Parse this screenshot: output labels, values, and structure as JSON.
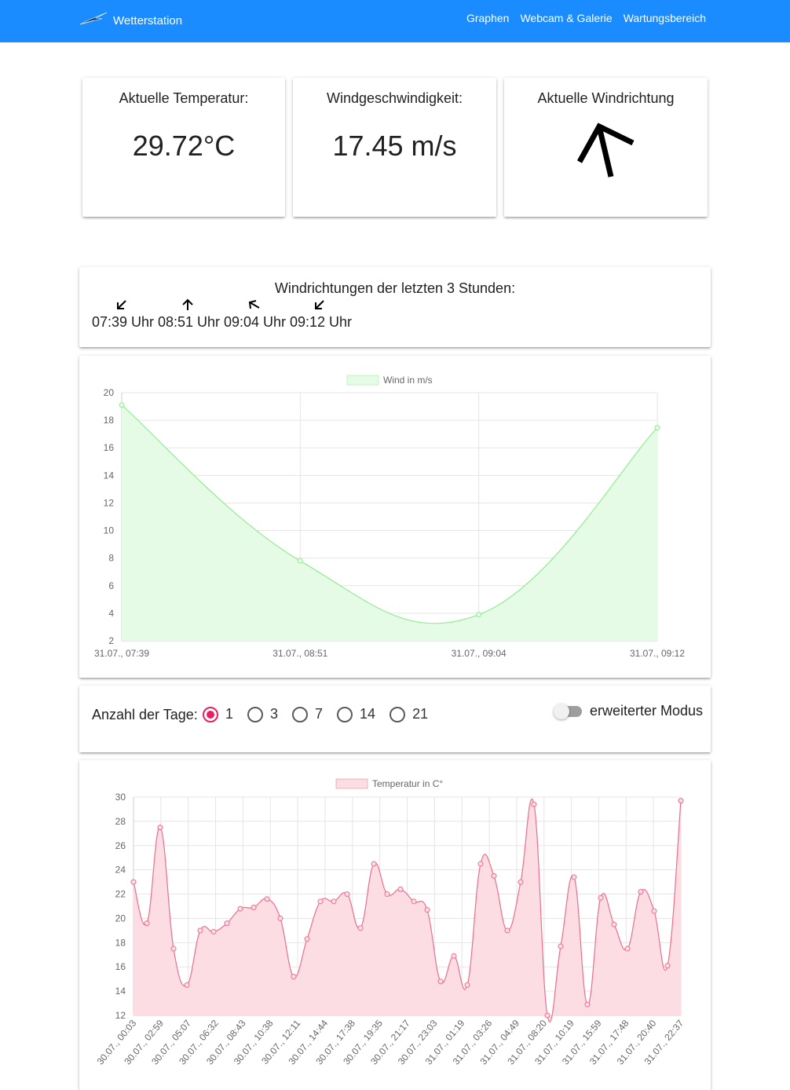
{
  "nav": {
    "brand": "Wetterstation",
    "links": [
      "Graphen",
      "Webcam & Galerie",
      "Wartungsbereich"
    ]
  },
  "stats": {
    "temperature": {
      "title": "Aktuelle Temperatur:",
      "value": "29.72°C"
    },
    "wind_speed": {
      "title": "Windgeschwindigkeit:",
      "value": "17.45 m/s"
    },
    "wind_direction": {
      "title": "Aktuelle Windrichtung",
      "arrow_icon": "arrow-up-left-icon",
      "direction_deg": 330
    }
  },
  "history": {
    "title": "Windrichtungen der letzten 3 Stunden:",
    "items": [
      {
        "time": "07:39 Uhr",
        "direction_deg": 225
      },
      {
        "time": "08:51 Uhr",
        "direction_deg": 0
      },
      {
        "time": "09:04 Uhr",
        "direction_deg": 300
      },
      {
        "time": "09:12 Uhr",
        "direction_deg": 225
      }
    ]
  },
  "controls": {
    "days_label": "Anzahl der Tage:",
    "options": [
      "1",
      "3",
      "7",
      "14",
      "21"
    ],
    "selected": "1",
    "toggle_label": "erweiterter Modus",
    "toggle_on": false
  },
  "colors": {
    "navbar": "#1a8cff",
    "wind_line": "#90ee90",
    "wind_fill": "#e6fbe6",
    "temp_line": "#ea6f8e",
    "temp_fill": "#fcdde4",
    "radio_accent": "#e91e63"
  },
  "chart_data": [
    {
      "type": "area",
      "legend": "Wind in m/s",
      "x": [
        "31.07., 07:39",
        "31.07., 08:51",
        "31.07., 09:04",
        "31.07., 09:12"
      ],
      "values": [
        19.1,
        7.8,
        3.9,
        17.45
      ],
      "ylim": [
        2,
        20
      ],
      "yticks": [
        2,
        4,
        6,
        8,
        10,
        12,
        14,
        16,
        18,
        20
      ],
      "grid": true,
      "legend_position": "top"
    },
    {
      "type": "area",
      "legend": "Temperatur in C°",
      "x": [
        "30.07., 00:03",
        "30.07., 02:59",
        "30.07., 05:07",
        "30.07., 06:32",
        "30.07., 08:43",
        "30.07., 10:38",
        "30.07., 12:11",
        "30.07., 14:44",
        "30.07., 17:38",
        "30.07., 19:35",
        "30.07., 21:17",
        "30.07., 23:03",
        "31.07., 01:19",
        "31.07., 03:26",
        "31.07., 04:49",
        "31.07., 08:20",
        "31.07., 10:19",
        "31.07., 15:59",
        "31.07., 17:48",
        "31.07., 20:40",
        "31.07., 22:37"
      ],
      "values": [
        23.0,
        19.6,
        27.5,
        17.5,
        14.5,
        19.0,
        18.9,
        19.6,
        20.8,
        20.9,
        21.6,
        20.0,
        15.2,
        18.3,
        21.4,
        21.4,
        22.0,
        19.2,
        24.5,
        22.0,
        22.4,
        21.4,
        20.7,
        14.8,
        16.9,
        14.5,
        24.5,
        23.5,
        19.0,
        23.0,
        29.4,
        12.0,
        17.7,
        23.4,
        12.9,
        21.7,
        19.5,
        17.5,
        22.2,
        20.6,
        16.1,
        29.7
      ],
      "ylim": [
        12,
        30
      ],
      "yticks": [
        12,
        14,
        16,
        18,
        20,
        22,
        24,
        26,
        28,
        30
      ],
      "grid": true,
      "legend_position": "top"
    }
  ]
}
